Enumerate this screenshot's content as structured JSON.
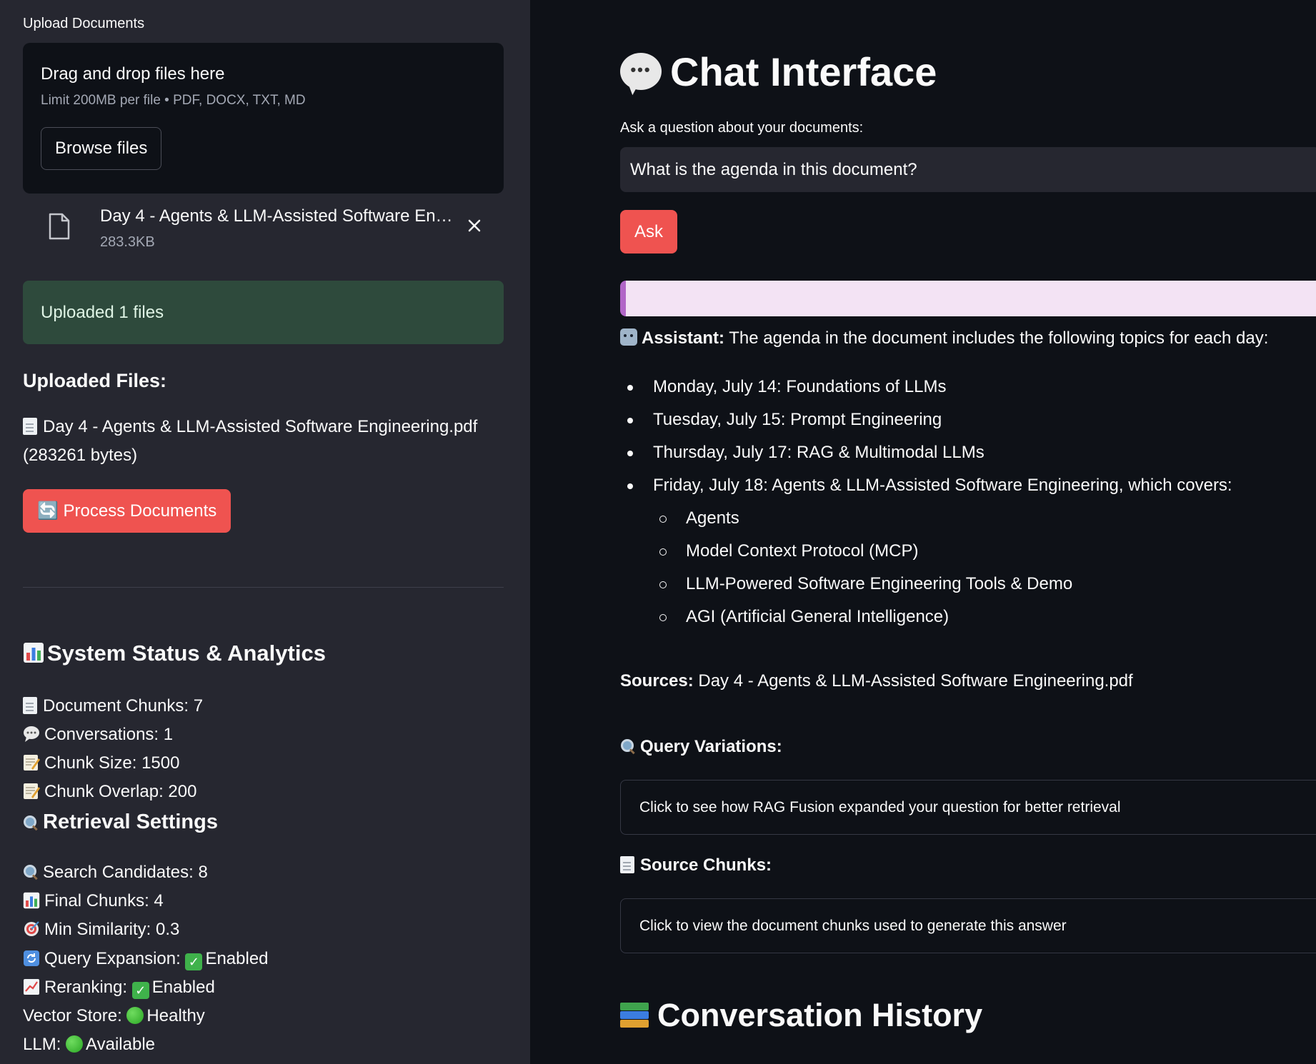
{
  "sidebar": {
    "upload_label": "Upload Documents",
    "dropzone": {
      "title": "Drag and drop files here",
      "subtitle": "Limit 200MB per file • PDF, DOCX, TXT, MD",
      "browse_label": "Browse files"
    },
    "file": {
      "name": "Day 4 - Agents & LLM-Assisted Software Engin…",
      "size": "283.3KB"
    },
    "success_message": "Uploaded 1 files",
    "uploaded_title": "Uploaded Files:",
    "uploaded_file_line": "Day 4 - Agents & LLM-Assisted Software Engineering.pdf (283261 bytes)",
    "process_label": "🔄 Process Documents",
    "system_title": "System Status & Analytics",
    "stats": {
      "document_chunks": "Document Chunks: 7",
      "conversations": "Conversations: 1",
      "chunk_size": "Chunk Size: 1500",
      "chunk_overlap": "Chunk Overlap: 200"
    },
    "retrieval_title": "Retrieval Settings",
    "retrieval": {
      "search_candidates": "Search Candidates: 8",
      "final_chunks": "Final Chunks: 4",
      "min_similarity": "Min Similarity: 0.3",
      "query_expansion_label": "Query Expansion:",
      "query_expansion_value": "Enabled",
      "reranking_label": "Reranking:",
      "reranking_value": "Enabled",
      "vector_store_label": "Vector Store:",
      "vector_store_value": "Healthy",
      "llm_label": "LLM:",
      "llm_value": "Available"
    }
  },
  "main": {
    "title": "Chat Interface",
    "ask_label": "Ask a question about your documents:",
    "ask_value": "What is the agenda in this document?",
    "ask_button": "Ask",
    "assistant_prefix": "Assistant:",
    "assistant_text": "The agenda in the document includes the following topics for each day:",
    "agenda": [
      "Monday, July 14: Foundations of LLMs",
      "Tuesday, July 15: Prompt Engineering",
      "Thursday, July 17: RAG & Multimodal LLMs",
      "Friday, July 18: Agents & LLM-Assisted Software Engineering, which covers:"
    ],
    "friday_topics": [
      "Agents",
      "Model Context Protocol (MCP)",
      "LLM-Powered Software Engineering Tools & Demo",
      "AGI (Artificial General Intelligence)"
    ],
    "sources_label": "Sources:",
    "sources_value": "Day 4 - Agents & LLM-Assisted Software Engineering.pdf",
    "query_variations_title": "Query Variations:",
    "query_variations_expander": "Click to see how RAG Fusion expanded your question for better retrieval",
    "source_chunks_title": "Source Chunks:",
    "source_chunks_expander": "Click to view the document chunks used to generate this answer",
    "history_title": "Conversation History"
  },
  "colors": {
    "sidebar_bg": "#262730",
    "main_bg": "#0e1117",
    "primary_button": "#ef5350",
    "success_bg": "#2e4a3c",
    "user_message_bg": "#f3e3f4",
    "user_message_accent": "#b166c7"
  },
  "icons": [
    "file-icon",
    "close-icon",
    "chart-icon",
    "document-icon",
    "speech-bubble-icon",
    "memo-icon",
    "magnifier-icon",
    "target-icon",
    "refresh-icon",
    "trend-icon",
    "check-icon",
    "green-dot-icon",
    "robot-icon",
    "books-icon"
  ]
}
